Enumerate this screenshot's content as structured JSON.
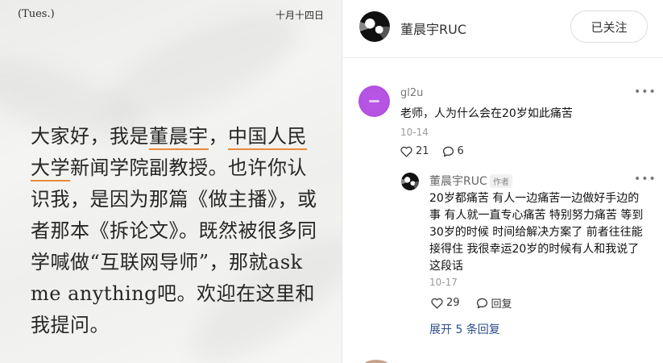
{
  "image": {
    "weekday": "(Tues.)",
    "cn_date": "十月十四日",
    "intro_segments": [
      {
        "text": "大家好，我是",
        "hl": false
      },
      {
        "text": "董晨宇",
        "hl": true
      },
      {
        "text": "，",
        "hl": false
      },
      {
        "text": "中国人民大学",
        "hl": true
      },
      {
        "text": "新闻学院副教授。也许你认识我，是因为那篇《做主播》，或者那本《拆论文》。既然被很多同学喊做“互联网导师”，那就ask me anything吧。欢迎在这里和我提问。",
        "hl": false
      }
    ],
    "highlight_color": "#e98a3a"
  },
  "author": {
    "name": "董晨宇RUC",
    "follow_label": "已关注"
  },
  "comments": [
    {
      "user": "gl2u",
      "text": "老师，人为什么会在20岁如此痛苦",
      "date": "10-14",
      "likes": "21",
      "replies": "6",
      "avatar_color": "#b553e2"
    }
  ],
  "reply": {
    "user": "董晨宇RUC",
    "badge": "作者",
    "text": "20岁都痛苦 有人一边痛苦一边做好手边的事 有人就一直专心痛苦 特别努力痛苦 等到30岁的时候 时间给解决方案了 前者往往能接得住 我很幸运20岁的时候有人和我说了这段话",
    "date": "10-17",
    "likes": "29",
    "reply_label": "回复"
  },
  "expand_label": "展开 5 条回复",
  "icons": [
    "more-icon",
    "heart-icon",
    "comment-icon"
  ],
  "link_color": "#2c4d8a"
}
